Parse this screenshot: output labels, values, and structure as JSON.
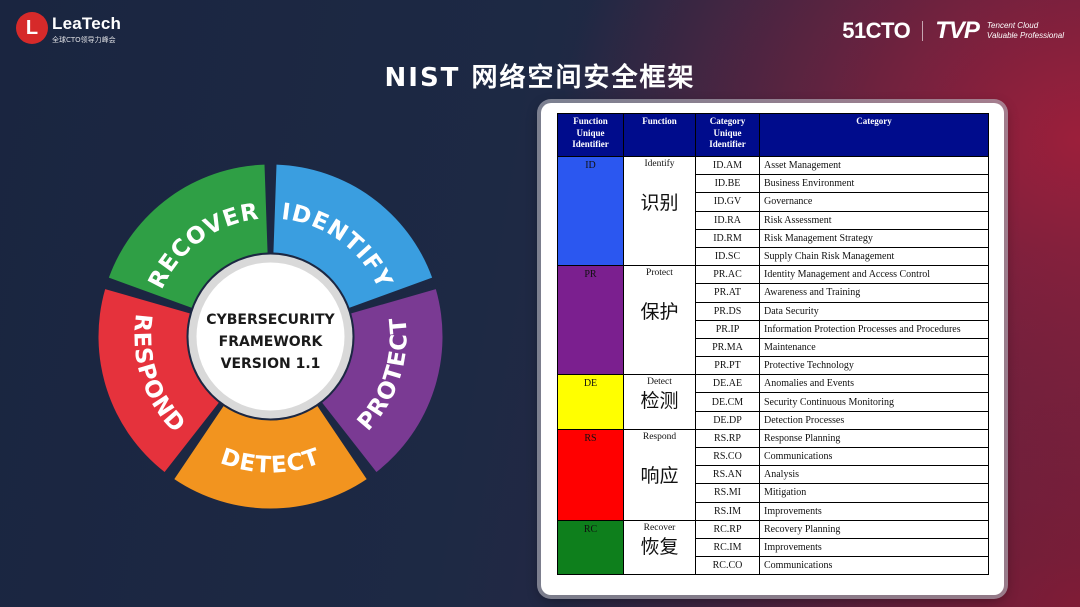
{
  "header": {
    "left_logo_mark": "L",
    "left_logo_name": "LeaTech",
    "left_logo_sub": "全球CTO领导力峰会",
    "right_brand_51cto": "51CTO",
    "right_brand_tvp": "TVP",
    "right_brand_tagline": [
      "Tencent Cloud",
      "Valuable Professional"
    ]
  },
  "title": "NIST 网络空间安全框架",
  "wheel": {
    "center_lines": [
      "CYBERSECURITY",
      "FRAMEWORK",
      "VERSION 1.1"
    ],
    "segments": [
      {
        "label": "IDENTIFY",
        "color": "#3a9ee0"
      },
      {
        "label": "PROTECT",
        "color": "#7a3a93"
      },
      {
        "label": "DETECT",
        "color": "#f2941f"
      },
      {
        "label": "RESPOND",
        "color": "#e5323c"
      },
      {
        "label": "RECOVER",
        "color": "#2f9f45"
      }
    ]
  },
  "table": {
    "headers": [
      "Function Unique Identifier",
      "Function",
      "Category Unique Identifier",
      "Category"
    ],
    "functions": [
      {
        "id": "ID",
        "name": "Identify",
        "zh": "识别",
        "color": "#2b57f0",
        "categories": [
          {
            "cid": "ID.AM",
            "name": "Asset Management"
          },
          {
            "cid": "ID.BE",
            "name": "Business Environment"
          },
          {
            "cid": "ID.GV",
            "name": "Governance"
          },
          {
            "cid": "ID.RA",
            "name": "Risk Assessment"
          },
          {
            "cid": "ID.RM",
            "name": "Risk Management Strategy"
          },
          {
            "cid": "ID.SC",
            "name": "Supply Chain Risk Management"
          }
        ]
      },
      {
        "id": "PR",
        "name": "Protect",
        "zh": "保护",
        "color": "#7b1f8f",
        "categories": [
          {
            "cid": "PR.AC",
            "name": "Identity Management and Access Control"
          },
          {
            "cid": "PR.AT",
            "name": "Awareness and Training"
          },
          {
            "cid": "PR.DS",
            "name": "Data Security"
          },
          {
            "cid": "PR.IP",
            "name": "Information Protection Processes and Procedures"
          },
          {
            "cid": "PR.MA",
            "name": "Maintenance"
          },
          {
            "cid": "PR.PT",
            "name": "Protective Technology"
          }
        ]
      },
      {
        "id": "DE",
        "name": "Detect",
        "zh": "检测",
        "color": "#ffff00",
        "categories": [
          {
            "cid": "DE.AE",
            "name": "Anomalies and Events"
          },
          {
            "cid": "DE.CM",
            "name": "Security Continuous Monitoring"
          },
          {
            "cid": "DE.DP",
            "name": "Detection Processes"
          }
        ]
      },
      {
        "id": "RS",
        "name": "Respond",
        "zh": "响应",
        "color": "#ff0000",
        "categories": [
          {
            "cid": "RS.RP",
            "name": "Response Planning"
          },
          {
            "cid": "RS.CO",
            "name": "Communications"
          },
          {
            "cid": "RS.AN",
            "name": "Analysis"
          },
          {
            "cid": "RS.MI",
            "name": "Mitigation"
          },
          {
            "cid": "RS.IM",
            "name": "Improvements"
          }
        ]
      },
      {
        "id": "RC",
        "name": "Recover",
        "zh": "恢复",
        "color": "#0e7f1c",
        "categories": [
          {
            "cid": "RC.RP",
            "name": "Recovery Planning"
          },
          {
            "cid": "RC.IM",
            "name": "Improvements"
          },
          {
            "cid": "RC.CO",
            "name": "Communications"
          }
        ]
      }
    ]
  }
}
